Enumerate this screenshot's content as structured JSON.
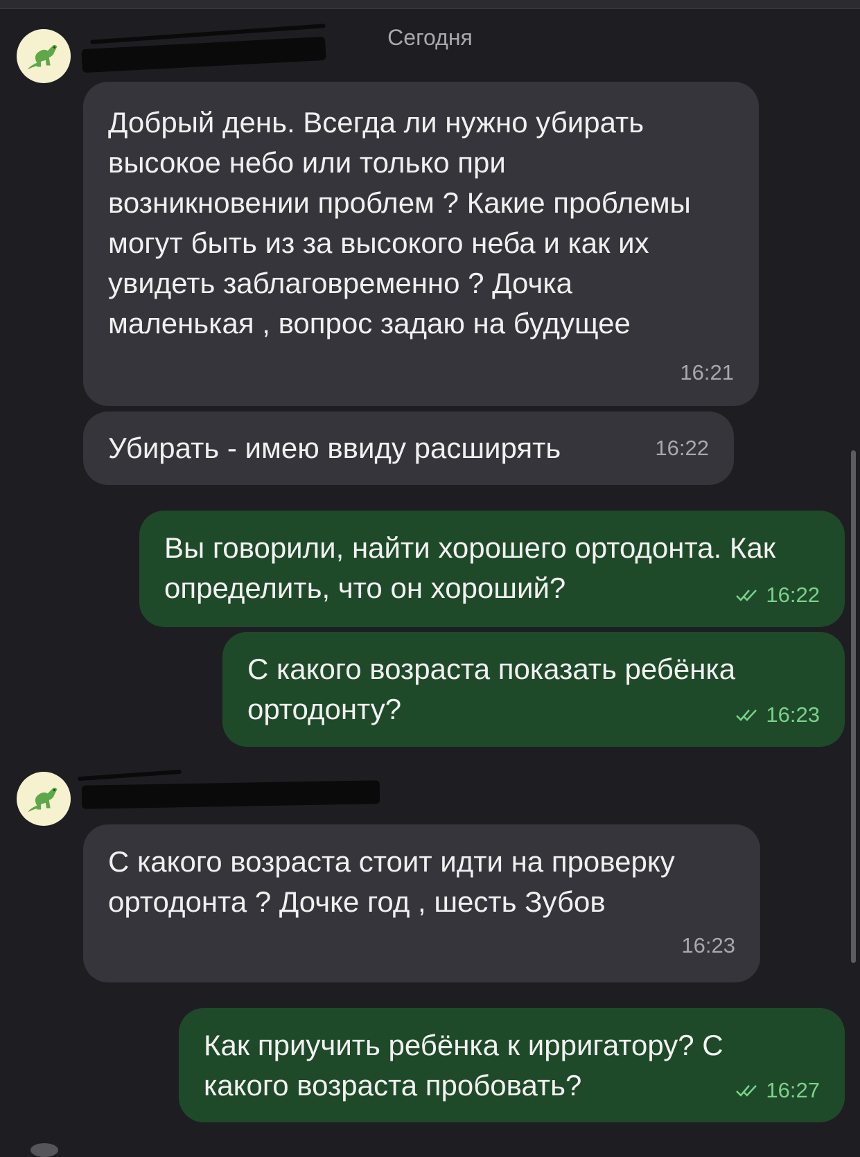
{
  "date_separator": "Сегодня",
  "colors": {
    "background": "#1e1e22",
    "incoming_bubble": "#35353b",
    "outgoing_bubble": "#1f4a2a",
    "outgoing_meta": "#79d38b"
  },
  "icons": {
    "avatar": "dinosaur-icon",
    "read_receipt": "double-check-icon"
  },
  "messages": [
    {
      "direction": "incoming",
      "text": "Добрый день. Всегда ли нужно убирать высокое небо или только при возникновении проблем ? Какие проблемы могут быть из за высокого неба и как их увидеть заблаговременно ? Дочка маленькая , вопрос задаю на будущее",
      "time": "16:21"
    },
    {
      "direction": "incoming",
      "text": "Убирать - имею ввиду расширять",
      "time": "16:22"
    },
    {
      "direction": "outgoing",
      "text": "Вы говорили, найти хорошего ортодонта. Как определить, что он хороший?",
      "time": "16:22",
      "read": true
    },
    {
      "direction": "outgoing",
      "text": "С какого возраста показать ребёнка ортодонту?",
      "time": "16:23",
      "read": true
    },
    {
      "direction": "incoming",
      "text": "С какого возраста стоит идти на проверку ортодонта ? Дочке год , шесть Зубов",
      "time": "16:23"
    },
    {
      "direction": "outgoing",
      "text": "Как приучить ребёнка к ирригатору? С какого возраста пробовать?",
      "time": "16:27",
      "read": true
    }
  ]
}
